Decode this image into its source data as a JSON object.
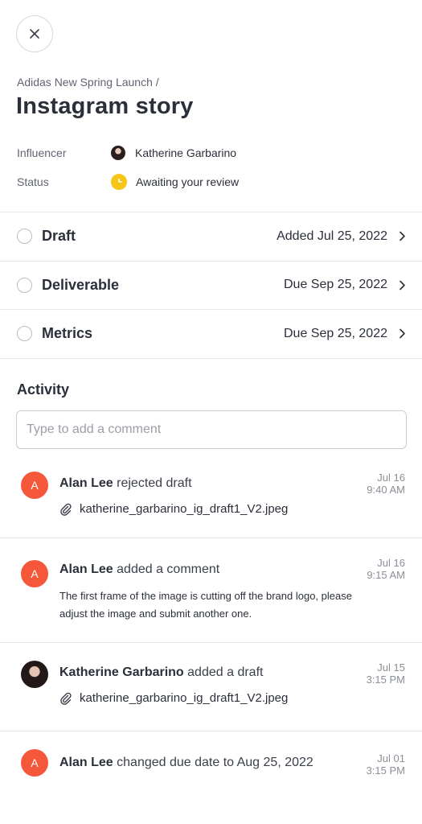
{
  "header": {
    "breadcrumb": "Adidas New Spring Launch /",
    "title": "Instagram story"
  },
  "meta": {
    "influencer_label": "Influencer",
    "influencer_name": "Katherine Garbarino",
    "status_label": "Status",
    "status_value": "Awaiting your review",
    "status_color": "#f5c518"
  },
  "tasks": [
    {
      "name": "Draft",
      "date": "Added Jul 25, 2022"
    },
    {
      "name": "Deliverable",
      "date": "Due Sep 25, 2022"
    },
    {
      "name": "Metrics",
      "date": "Due Sep 25, 2022"
    }
  ],
  "activity": {
    "heading": "Activity",
    "comment_placeholder": "Type to add a comment",
    "items": [
      {
        "initial": "A",
        "actor": "Alan Lee",
        "action": "rejected draft",
        "date": "Jul 16",
        "time": "9:40 AM",
        "attachment": "katherine_garbarino_ig_draft1_V2.jpeg"
      },
      {
        "initial": "A",
        "actor": "Alan Lee",
        "action": "added a comment",
        "date": "Jul 16",
        "time": "9:15 AM",
        "comment": "The first frame of the image is cutting off the brand logo, please adjust the image and submit another one."
      },
      {
        "actor": "Katherine Garbarino",
        "action": "added a draft",
        "date": "Jul 15",
        "time": "3:15 PM",
        "attachment": "katherine_garbarino_ig_draft1_V2.jpeg"
      },
      {
        "initial": "A",
        "actor": "Alan Lee",
        "action": "changed due date to Aug 25, 2022",
        "date": "Jul 01",
        "time": "3:15 PM"
      }
    ]
  },
  "colors": {
    "avatar_accent": "#f5573b",
    "text_primary": "#2b2f3a",
    "divider": "#e6e8eb"
  }
}
